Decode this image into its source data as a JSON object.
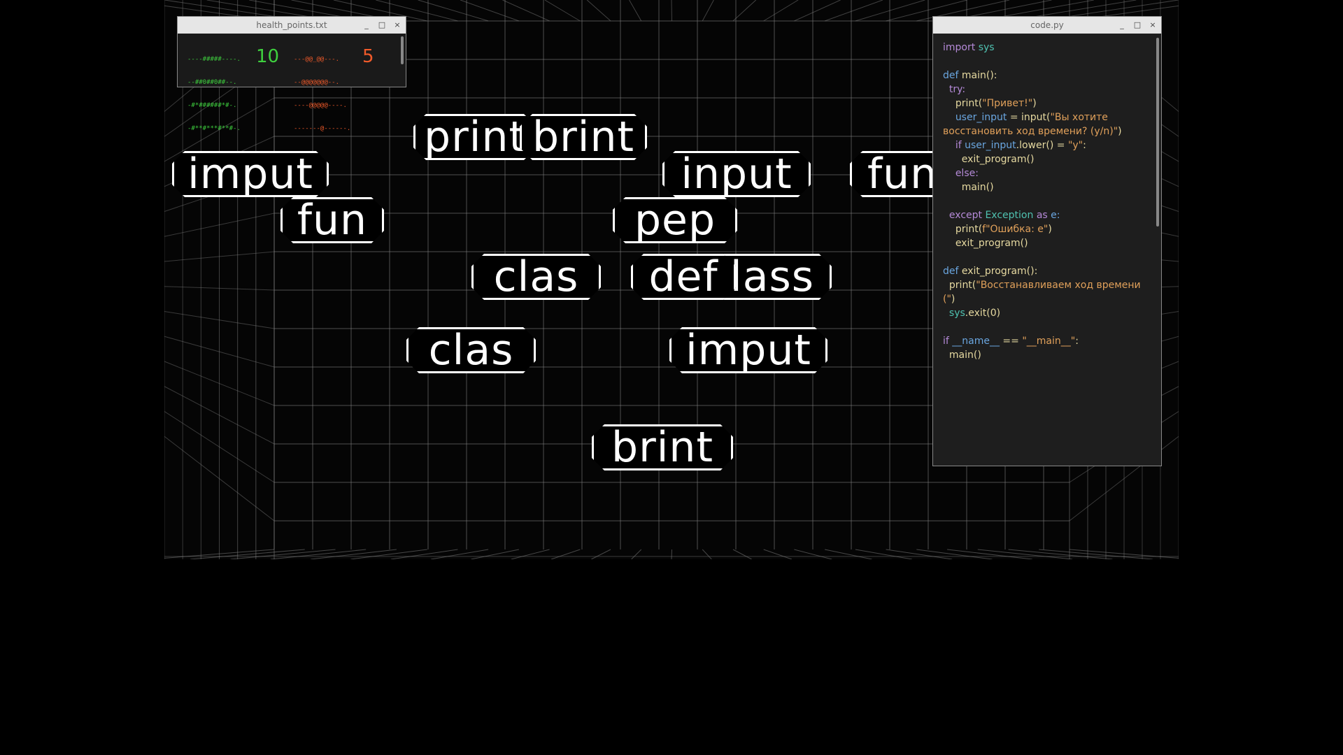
{
  "health_window": {
    "title": "health_points.txt",
    "controls": [
      "_",
      "□",
      "×"
    ],
    "player": {
      "ascii": [
        "----#####----.",
        "--##0##0##--.",
        "-#*######*#-.",
        "-#**#***#**#-."
      ],
      "hp": "10",
      "color": "#3ecf3e"
    },
    "enemy": {
      "ascii": [
        "---@@_@@---.",
        "--@@@@@@@--.",
        "----@@@@@----.",
        "-------@------."
      ],
      "hp": "5",
      "color": "#f05a2a"
    }
  },
  "code_window": {
    "title": "code.py",
    "controls": [
      "_",
      "□",
      "×"
    ],
    "lines": [
      [
        {
          "t": "import ",
          "c": "kw"
        },
        {
          "t": "sys",
          "c": "teal"
        }
      ],
      [],
      [
        {
          "t": "def ",
          "c": "blue"
        },
        {
          "t": "main():",
          "c": "fn"
        }
      ],
      [
        {
          "t": "  try:",
          "c": "kw"
        }
      ],
      [
        {
          "t": "    print(",
          "c": "fn"
        },
        {
          "t": "\"Привет!\"",
          "c": "str"
        },
        {
          "t": ")",
          "c": "fn"
        }
      ],
      [
        {
          "t": "    user_input",
          "c": "blue"
        },
        {
          "t": " = input(",
          "c": "fn"
        },
        {
          "t": "\"Вы хотите",
          "c": "str"
        }
      ],
      [
        {
          "t": "восстановить ход времени? (y/n)\"",
          "c": "str"
        },
        {
          "t": ")",
          "c": "fn"
        }
      ],
      [
        {
          "t": "    if ",
          "c": "kw"
        },
        {
          "t": "user_input",
          "c": "blue"
        },
        {
          "t": ".lower() = ",
          "c": "fn"
        },
        {
          "t": "\"y\"",
          "c": "str"
        },
        {
          "t": ":",
          "c": "fn"
        }
      ],
      [
        {
          "t": "      exit_program()",
          "c": "fn"
        }
      ],
      [
        {
          "t": "    else:",
          "c": "kw"
        }
      ],
      [
        {
          "t": "      main()",
          "c": "fn"
        }
      ],
      [],
      [
        {
          "t": "  except ",
          "c": "kw"
        },
        {
          "t": "Exception ",
          "c": "teal"
        },
        {
          "t": "as ",
          "c": "kw"
        },
        {
          "t": "e:",
          "c": "blue"
        }
      ],
      [
        {
          "t": "    print(",
          "c": "fn"
        },
        {
          "t": "f\"Ошибка: e\"",
          "c": "str"
        },
        {
          "t": ")",
          "c": "fn"
        }
      ],
      [
        {
          "t": "    exit_program()",
          "c": "fn"
        }
      ],
      [],
      [
        {
          "t": "def ",
          "c": "blue"
        },
        {
          "t": "exit_program():",
          "c": "fn"
        }
      ],
      [
        {
          "t": "  print(",
          "c": "fn"
        },
        {
          "t": "\"Восстанавливаем ход времени",
          "c": "str"
        }
      ],
      [
        {
          "t": "(\"",
          "c": "str"
        },
        {
          "t": ")",
          "c": "fn"
        }
      ],
      [
        {
          "t": "  sys",
          "c": "teal"
        },
        {
          "t": ".exit(0)",
          "c": "fn"
        }
      ],
      [],
      [
        {
          "t": "if ",
          "c": "kw"
        },
        {
          "t": "__name__",
          "c": "blue"
        },
        {
          "t": " == ",
          "c": "fn"
        },
        {
          "t": "\"__main__\"",
          "c": "str"
        },
        {
          "t": ":",
          "c": "fn"
        }
      ],
      [
        {
          "t": "  main()",
          "c": "fn"
        }
      ]
    ]
  },
  "tokens": [
    {
      "id": "token-print",
      "text": "print"
    },
    {
      "id": "token-brint-top",
      "text": "brint"
    },
    {
      "id": "token-imput-left",
      "text": "imput"
    },
    {
      "id": "token-input",
      "text": "input"
    },
    {
      "id": "token-fun-right",
      "text": "fun"
    },
    {
      "id": "token-fun",
      "text": "fun"
    },
    {
      "id": "token-pep",
      "text": "pep"
    },
    {
      "id": "token-clas-1",
      "text": "clas"
    },
    {
      "id": "token-class",
      "text": "class"
    },
    {
      "id": "token-def",
      "text": "def"
    },
    {
      "id": "token-clas-2",
      "text": "clas"
    },
    {
      "id": "token-imput-right",
      "text": "imput"
    },
    {
      "id": "token-brint-bottom",
      "text": "brint"
    }
  ]
}
